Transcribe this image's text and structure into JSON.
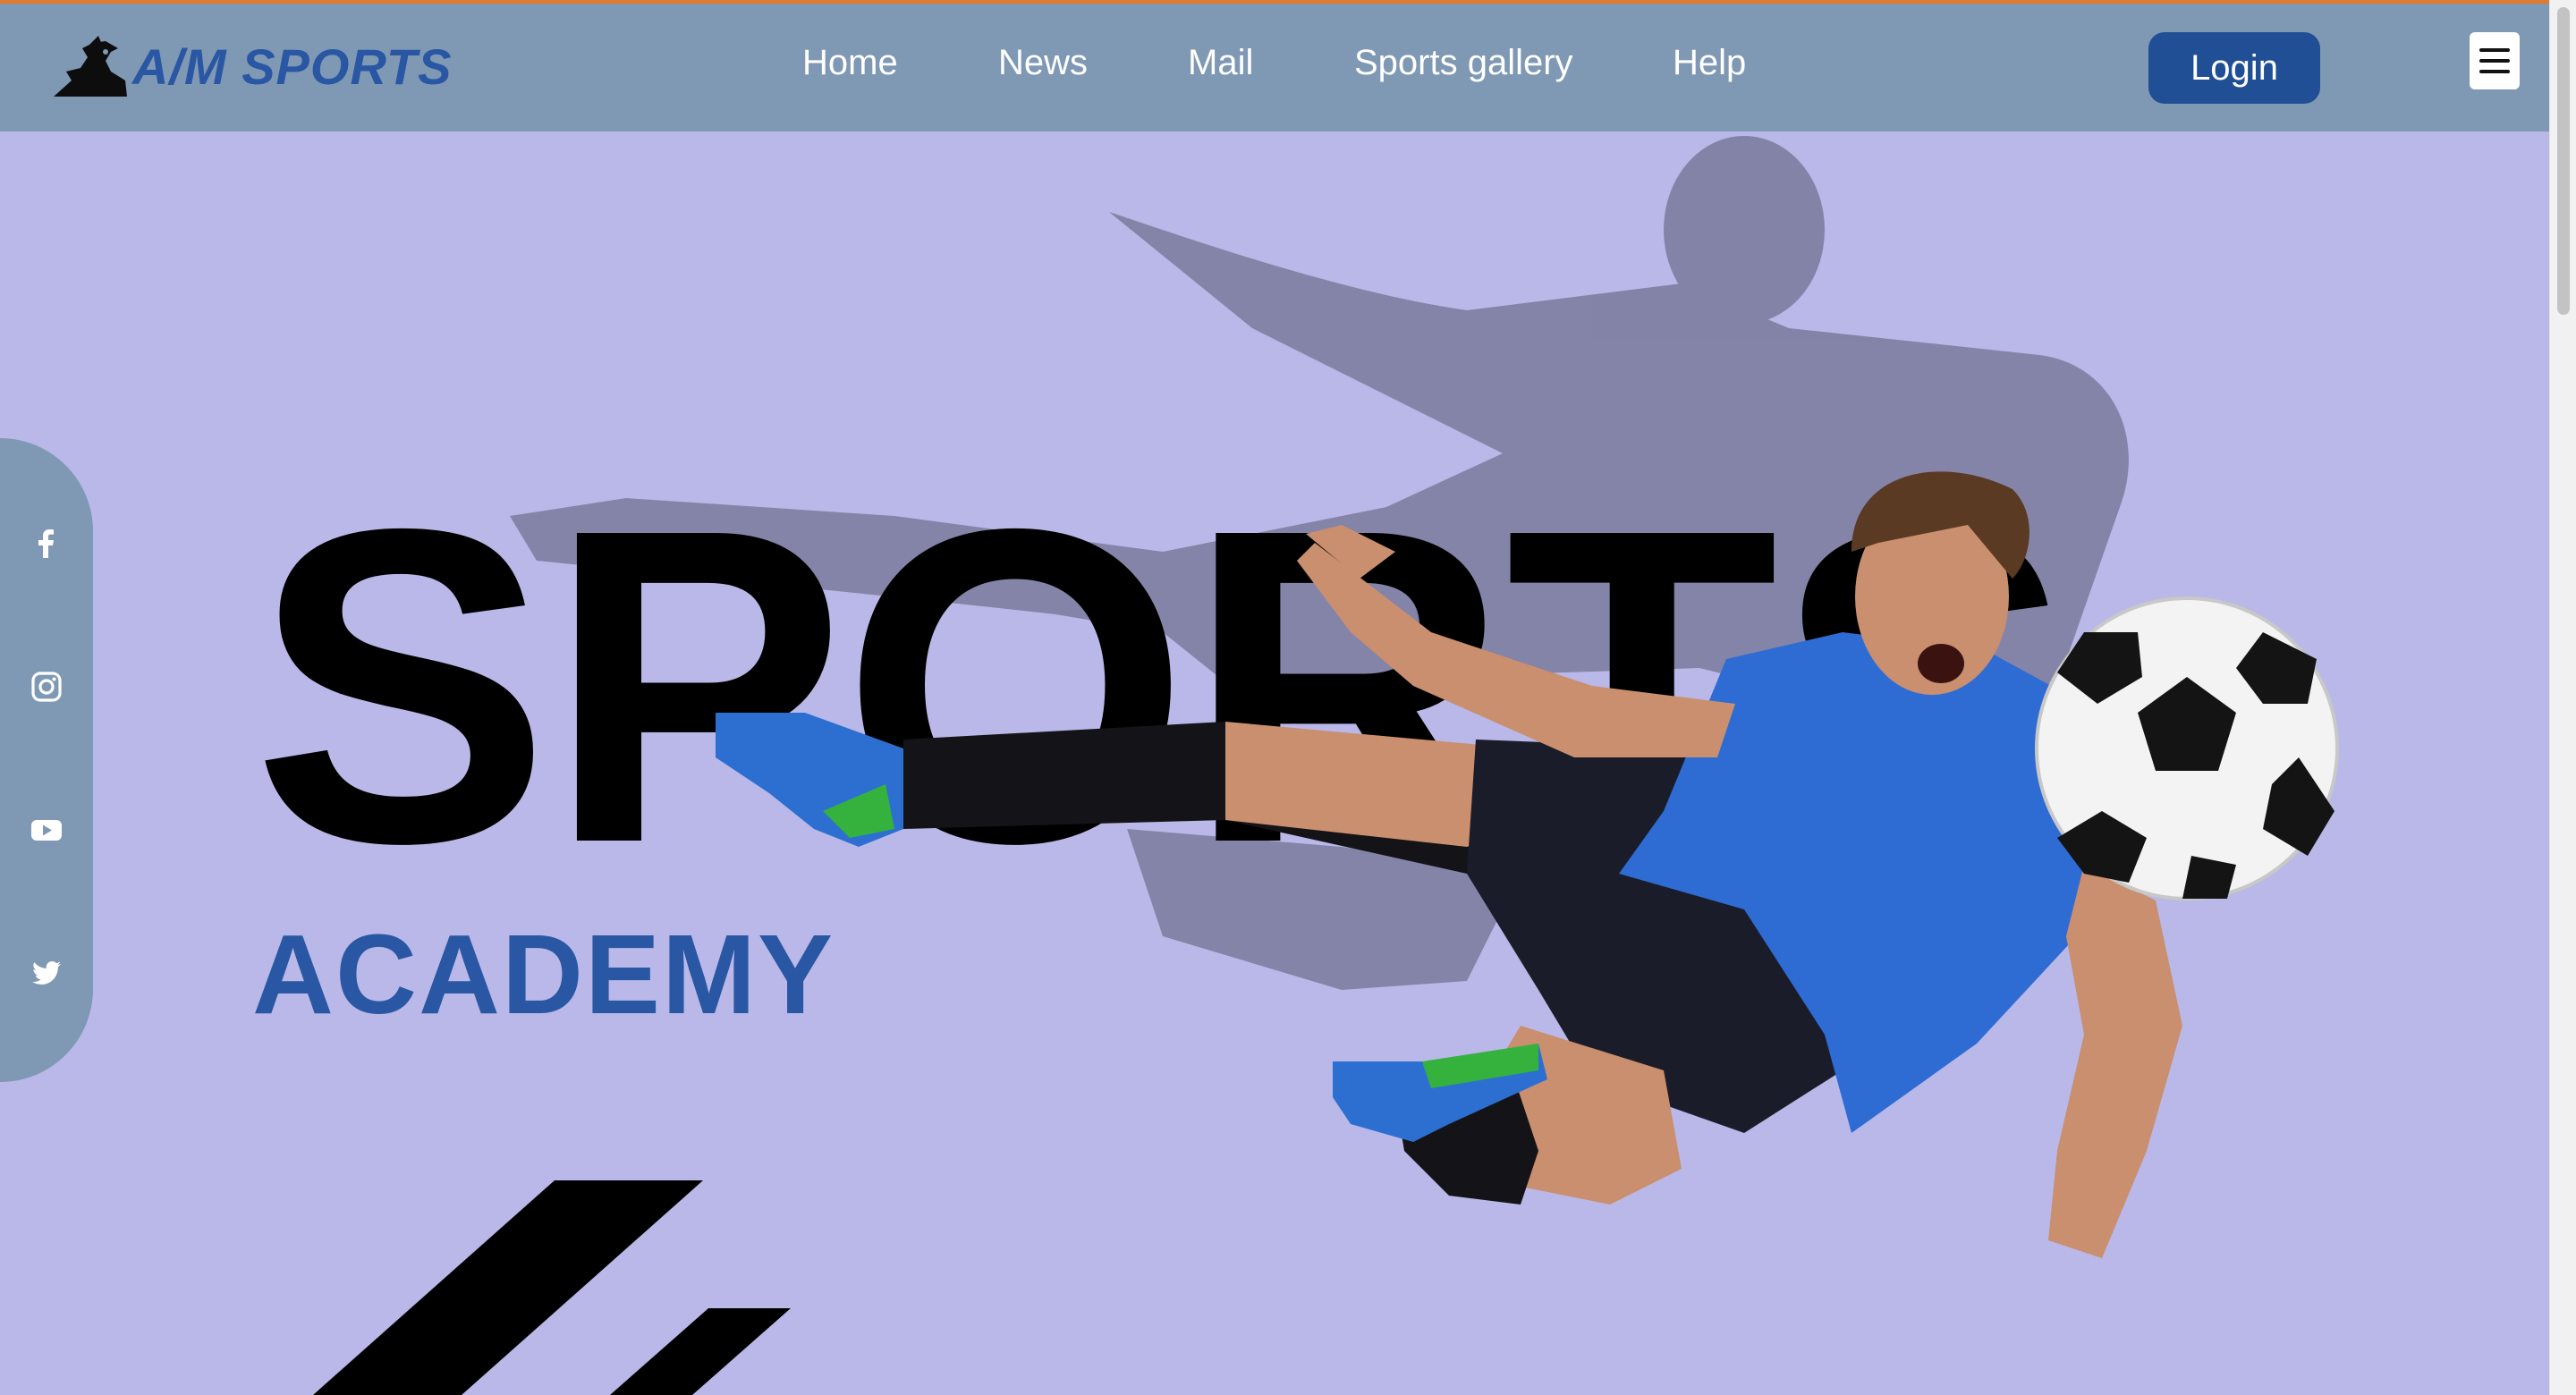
{
  "brand": {
    "logo_text": "A/M SPORTS",
    "logo_icon": "dragon-logo-icon"
  },
  "nav": {
    "items": [
      {
        "label": "Home"
      },
      {
        "label": "News"
      },
      {
        "label": "Mail"
      },
      {
        "label": "Sports gallery"
      },
      {
        "label": "Help"
      }
    ],
    "login_label": "Login",
    "menu_icon": "hamburger-menu-icon"
  },
  "hero": {
    "title": "SPORTS",
    "subtitle": "ACADEMY"
  },
  "social": {
    "items": [
      {
        "icon": "facebook-icon"
      },
      {
        "icon": "instagram-icon"
      },
      {
        "icon": "youtube-icon"
      },
      {
        "icon": "twitter-icon"
      }
    ]
  },
  "colors": {
    "header_bg": "#7f98b4",
    "hero_bg": "#b9b8e8",
    "brand_blue": "#2a57a3",
    "login_bg": "#214f95",
    "accent_orange": "#e07a2e"
  }
}
